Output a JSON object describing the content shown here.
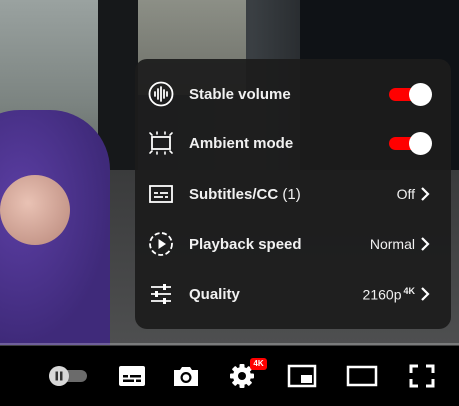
{
  "settings_menu": {
    "items": [
      {
        "label": "Stable volume",
        "toggle": true,
        "icon": "stable-volume-icon"
      },
      {
        "label": "Ambient mode",
        "toggle": true,
        "icon": "ambient-mode-icon"
      },
      {
        "label": "Subtitles/CC",
        "count": "(1)",
        "value": "Off",
        "icon": "subtitles-icon"
      },
      {
        "label": "Playback speed",
        "value": "Normal",
        "icon": "playback-speed-icon"
      },
      {
        "label": "Quality",
        "value": "2160p",
        "value_badge": "4K",
        "icon": "quality-icon"
      }
    ]
  },
  "controls": {
    "settings_badge": "4K",
    "icons": [
      "autoplay-toggle-icon",
      "subtitles-icon",
      "camera-icon",
      "settings-gear-icon",
      "miniplayer-icon",
      "theater-mode-icon",
      "fullscreen-icon"
    ]
  },
  "colors": {
    "accent": "#ff0000",
    "menu_bg": "#1c1c1c",
    "text": "#f1f1f1"
  }
}
